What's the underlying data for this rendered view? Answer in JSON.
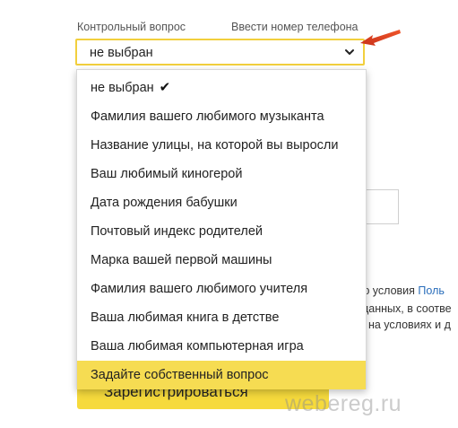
{
  "form": {
    "security_question_label": "Контрольный вопрос",
    "phone_link_label": "Ввести номер телефона",
    "selected_value": "не выбран",
    "register_button_label": "Зарегистрироваться"
  },
  "dropdown": {
    "options": [
      "не выбран",
      "Фамилия вашего любимого музыканта",
      "Название улицы, на которой вы выросли",
      "Ваш любимый киногерой",
      "Дата рождения бабушки",
      "Почтовый индекс родителей",
      "Марка вашей первой машины",
      "Фамилия вашего любимого учителя",
      "Ваша любимая книга в детстве",
      "Ваша любимая компьютерная игра",
      "Задайте собственный вопрос"
    ],
    "checkmark": "✔",
    "highlight_color": "#f6dc52"
  },
  "background_text": {
    "line1_prefix": "аю условия",
    "line1_link": "Поль",
    "line2": "данных, в соотве",
    "line3": ", на условиях и д"
  },
  "watermark": "webereg.ru",
  "colors": {
    "accent_yellow": "#f6da3c",
    "select_border": "#f2cf3d",
    "arrow_red": "#e2411e",
    "link_blue": "#2a6ebb"
  },
  "icons": {
    "select_chevron": "chevron-down-icon",
    "pointer_arrow": "red-arrow-icon",
    "selected_check": "checkmark-icon"
  }
}
